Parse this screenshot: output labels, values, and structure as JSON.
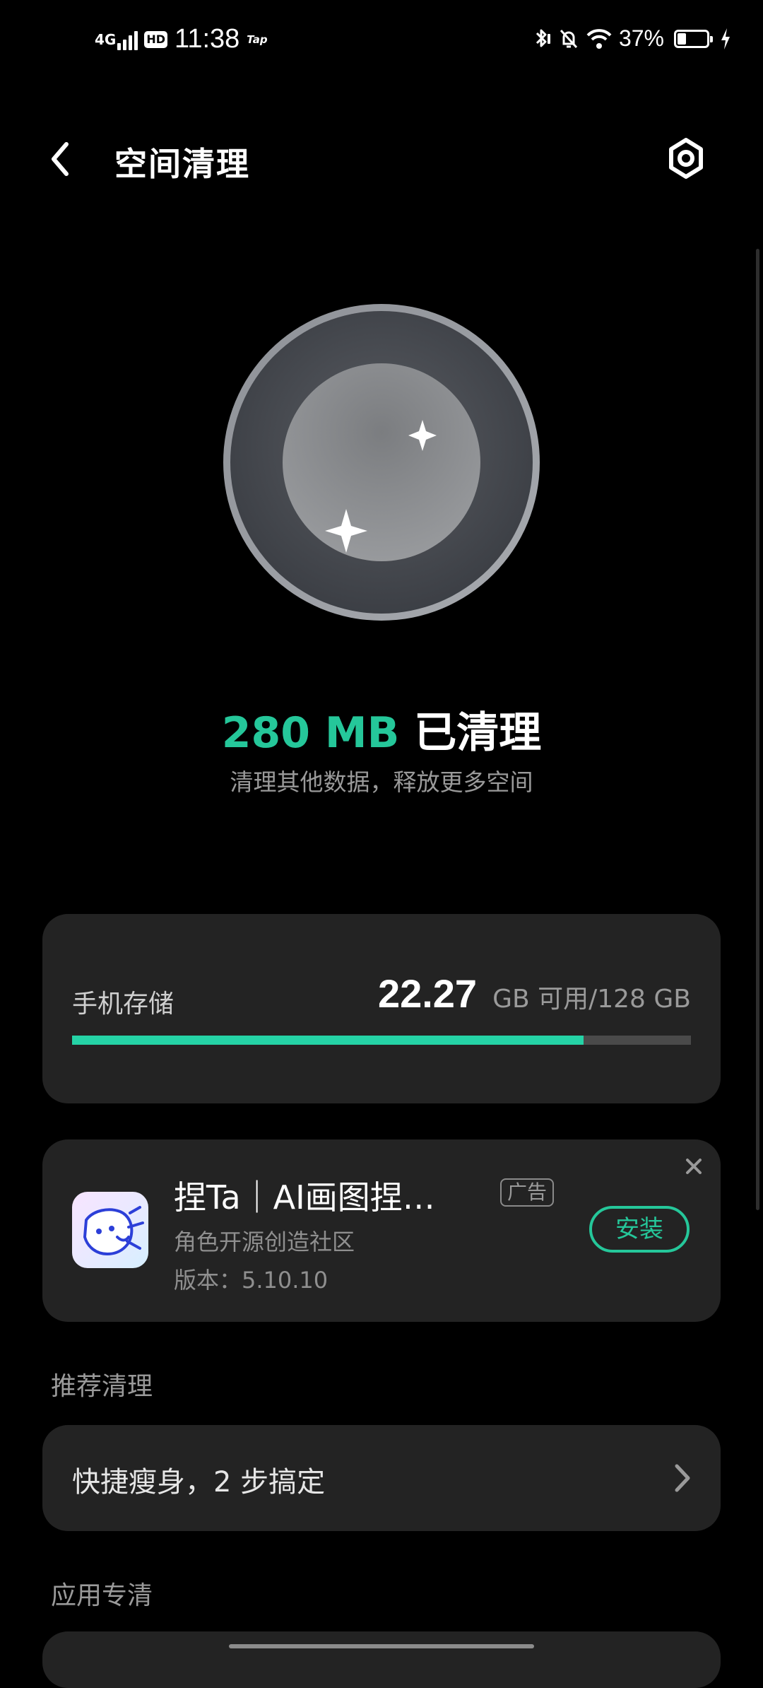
{
  "status_bar": {
    "network": "4G",
    "hd": "HD",
    "time": "11:38",
    "tap_label": "Tap",
    "battery_pct": "37%",
    "battery_level": 0.37
  },
  "header": {
    "title": "空间清理"
  },
  "hero": {
    "cleaned_amount": "280 MB",
    "cleaned_suffix": " 已清理",
    "subtitle": "清理其他数据，释放更多空间"
  },
  "storage": {
    "label": "手机存储",
    "free_value": "22.27",
    "rest_text": "GB 可用/128 GB",
    "used_fraction": 0.826
  },
  "ad": {
    "title": "捏Ta｜AI画图捏…",
    "badge": "广告",
    "description": "角色开源创造社区",
    "version": "版本：5.10.10",
    "install_label": "安装"
  },
  "sections": {
    "recommended": "推荐清理",
    "app_specific": "应用专清"
  },
  "quick_item": {
    "label": "快捷瘦身，2 步搞定"
  },
  "colors": {
    "accent": "#25c79a",
    "background": "#000000",
    "card": "#232323"
  },
  "icons": {
    "back": "back-arrow-icon",
    "settings": "settings-gear-icon",
    "close": "close-icon",
    "chevron": "chevron-right-icon"
  }
}
